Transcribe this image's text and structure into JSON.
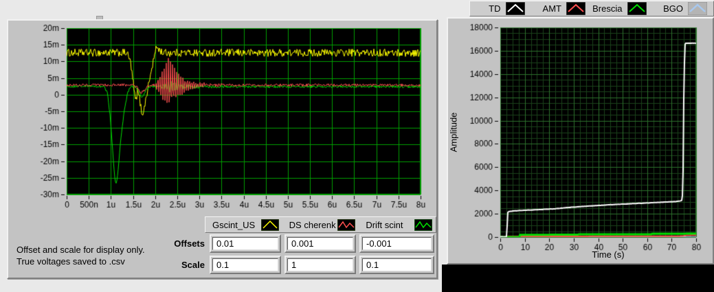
{
  "left_panel": {
    "note_line1": "Offset and scale for display only.",
    "note_line2": "True voltages saved to .csv",
    "offsets_label": "Offsets",
    "scale_label": "Scale",
    "offsets": [
      "0.01",
      "0.001",
      "-0.001"
    ],
    "scale": [
      "0.1",
      "1",
      "0.1"
    ],
    "legend": [
      {
        "label": "Gscint_US",
        "color": "#ffff00",
        "box": "#000000",
        "glyph": "caret-line"
      },
      {
        "label": "DS cherenk",
        "color": "#ff5050",
        "box": "#000000",
        "glyph": "zigzag-line"
      },
      {
        "label": "Drift scint",
        "color": "#00e400",
        "box": "#000000",
        "glyph": "zigzag-line"
      }
    ]
  },
  "right_panel": {
    "ylabel": "Amplitude",
    "xlabel": "Time (s)",
    "legend": [
      {
        "label": "TD",
        "color": "#ffffff",
        "box": "#000000",
        "glyph": "caret-line"
      },
      {
        "label": "AMT",
        "color": "#ff5050",
        "box": "#000000",
        "glyph": "caret-line"
      },
      {
        "label": "Brescia",
        "color": "#00dd00",
        "box": "#000000",
        "glyph": "caret-line"
      },
      {
        "label": "BGO",
        "color": "#a8c8ee",
        "box": "#b4b4b4",
        "glyph": "caret-line"
      }
    ]
  },
  "chart_data": [
    {
      "type": "line",
      "title": "",
      "xlabel": "",
      "ylabel": "",
      "x_unit": "seconds (n = nano, u = micro)",
      "y_unit": "volts (m = milli)",
      "x_range": [
        0,
        8
      ],
      "y_range": [
        -30,
        20
      ],
      "grid": {
        "x_step": 0.5,
        "y_step": 5
      },
      "colors": {
        "bg": "#000000",
        "grid": "#00a000"
      },
      "x_ticks": [
        {
          "v": 0,
          "l": "0"
        },
        {
          "v": 0.5,
          "l": "500n"
        },
        {
          "v": 1,
          "l": "1u"
        },
        {
          "v": 1.5,
          "l": "1.5u"
        },
        {
          "v": 2,
          "l": "2u"
        },
        {
          "v": 2.5,
          "l": "2.5u"
        },
        {
          "v": 3,
          "l": "3u"
        },
        {
          "v": 3.5,
          "l": "3.5u"
        },
        {
          "v": 4,
          "l": "4u"
        },
        {
          "v": 4.5,
          "l": "4.5u"
        },
        {
          "v": 5,
          "l": "5u"
        },
        {
          "v": 5.5,
          "l": "5.5u"
        },
        {
          "v": 6,
          "l": "6u"
        },
        {
          "v": 6.5,
          "l": "6.5u"
        },
        {
          "v": 7,
          "l": "7u"
        },
        {
          "v": 7.5,
          "l": "7.5u"
        },
        {
          "v": 8,
          "l": "8u"
        }
      ],
      "y_ticks": [
        {
          "v": 20,
          "l": "20m"
        },
        {
          "v": 15,
          "l": "15m"
        },
        {
          "v": 10,
          "l": "10m"
        },
        {
          "v": 5,
          "l": "5m"
        },
        {
          "v": 0,
          "l": "0"
        },
        {
          "v": -5,
          "l": "-5m"
        },
        {
          "v": -10,
          "l": "-10m"
        },
        {
          "v": -15,
          "l": "-15m"
        },
        {
          "v": -20,
          "l": "-20m"
        },
        {
          "v": -25,
          "l": "-25m"
        },
        {
          "v": -30,
          "l": "-30m"
        }
      ],
      "series": [
        {
          "name": "Gscint_US",
          "color": "#ffff00",
          "width": 1,
          "noise": 1.15,
          "points": [
            [
              0,
              12.6
            ],
            [
              1.36,
              12.6
            ],
            [
              1.44,
              10
            ],
            [
              1.5,
              4
            ],
            [
              1.56,
              -2.3
            ],
            [
              1.6,
              1
            ],
            [
              1.64,
              -0.5
            ],
            [
              1.7,
              -5.8
            ],
            [
              1.75,
              -4.5
            ],
            [
              1.8,
              -0.5
            ],
            [
              1.86,
              3.5
            ],
            [
              1.92,
              7.5
            ],
            [
              1.98,
              11.5
            ],
            [
              2.04,
              14.6
            ],
            [
              2.1,
              13.4
            ],
            [
              2.18,
              12.6
            ],
            [
              8,
              12.6
            ]
          ]
        },
        {
          "name": "DS cherenk",
          "color": "#ff5050",
          "width": 1,
          "noise": 0.4,
          "points": [
            [
              0,
              2.9
            ],
            [
              1.5,
              2.9
            ],
            [
              1.6,
              2.2
            ],
            [
              1.68,
              0.6
            ],
            [
              1.74,
              1.2
            ],
            [
              1.82,
              2.4
            ],
            [
              1.95,
              2.9
            ],
            [
              8,
              2.9
            ]
          ],
          "ring": {
            "t0": 2.0,
            "peak": 2.3,
            "amp": 8.5,
            "decay": 0.28,
            "freq": 21,
            "end": 3.6
          }
        },
        {
          "name": "Drift scint",
          "color": "#00e400",
          "width": 1,
          "noise": 0.35,
          "points": [
            [
              0,
              2.5
            ],
            [
              0.84,
              2.5
            ],
            [
              0.92,
              0.5
            ],
            [
              0.98,
              -6
            ],
            [
              1.04,
              -17
            ],
            [
              1.09,
              -25.5
            ],
            [
              1.12,
              -27
            ],
            [
              1.16,
              -23
            ],
            [
              1.22,
              -14
            ],
            [
              1.3,
              -5
            ],
            [
              1.38,
              0.8
            ],
            [
              1.46,
              2.6
            ],
            [
              1.56,
              2.4
            ],
            [
              1.64,
              1
            ],
            [
              1.7,
              -1.2
            ],
            [
              1.78,
              1.2
            ],
            [
              1.86,
              2.4
            ],
            [
              8,
              2.4
            ]
          ],
          "ring": {
            "t0": 2.05,
            "peak": 2.35,
            "amp": 1.4,
            "decay": 0.4,
            "freq": 17,
            "end": 3.5
          }
        }
      ]
    },
    {
      "type": "line",
      "title": "",
      "xlabel": "Time (s)",
      "ylabel": "Amplitude",
      "x_range": [
        0,
        80
      ],
      "y_range": [
        0,
        18000
      ],
      "grid": {
        "minor_x": 2.5,
        "minor_y": 500,
        "major_x": 10,
        "major_y": 2000
      },
      "colors": {
        "bg": "#000000",
        "grid_minor": "#1b431b",
        "grid_major": "#2c722c"
      },
      "x_ticks": [
        {
          "v": 0,
          "l": "0"
        },
        {
          "v": 10,
          "l": "10"
        },
        {
          "v": 20,
          "l": "20"
        },
        {
          "v": 30,
          "l": "30"
        },
        {
          "v": 40,
          "l": "40"
        },
        {
          "v": 50,
          "l": "50"
        },
        {
          "v": 60,
          "l": "60"
        },
        {
          "v": 70,
          "l": "70"
        },
        {
          "v": 80,
          "l": "80"
        }
      ],
      "y_ticks": [
        {
          "v": 0,
          "l": "0"
        },
        {
          "v": 2000,
          "l": "2000"
        },
        {
          "v": 4000,
          "l": "4000"
        },
        {
          "v": 6000,
          "l": "6000"
        },
        {
          "v": 8000,
          "l": "8000"
        },
        {
          "v": 10000,
          "l": "10000"
        },
        {
          "v": 12000,
          "l": "12000"
        },
        {
          "v": 14000,
          "l": "14000"
        },
        {
          "v": 16000,
          "l": "16000"
        },
        {
          "v": 18000,
          "l": "18000"
        }
      ],
      "series": [
        {
          "name": "TD",
          "color": "#ffffff",
          "width": 2,
          "noise": 10,
          "points": [
            [
              0,
              20
            ],
            [
              2.5,
              20
            ],
            [
              2.7,
              300
            ],
            [
              3.0,
              2100
            ],
            [
              3.6,
              2200
            ],
            [
              6,
              2250
            ],
            [
              9,
              2290
            ],
            [
              12,
              2320
            ],
            [
              15,
              2350
            ],
            [
              18,
              2380
            ],
            [
              21,
              2410
            ],
            [
              24,
              2460
            ],
            [
              27,
              2520
            ],
            [
              30,
              2570
            ],
            [
              33,
              2620
            ],
            [
              36,
              2660
            ],
            [
              39,
              2700
            ],
            [
              42,
              2740
            ],
            [
              45,
              2780
            ],
            [
              48,
              2810
            ],
            [
              51,
              2840
            ],
            [
              54,
              2870
            ],
            [
              57,
              2900
            ],
            [
              60,
              2930
            ],
            [
              63,
              2960
            ],
            [
              66,
              2990
            ],
            [
              69,
              3020
            ],
            [
              71,
              3040
            ],
            [
              73,
              3080
            ],
            [
              74.2,
              3150
            ],
            [
              74.6,
              4000
            ],
            [
              74.9,
              11700
            ],
            [
              75.1,
              12200
            ],
            [
              75.3,
              16500
            ],
            [
              75.8,
              16650
            ],
            [
              80,
              16650
            ]
          ]
        },
        {
          "name": "AMT",
          "color": "#ff5050",
          "width": 2,
          "noise": 0,
          "points": [
            [
              0,
              10
            ],
            [
              2.5,
              10
            ],
            [
              3,
              55
            ],
            [
              20,
              60
            ],
            [
              40,
              68
            ],
            [
              60,
              72
            ],
            [
              73,
              78
            ],
            [
              74.5,
              90
            ],
            [
              76,
              140
            ],
            [
              78,
              155
            ],
            [
              80,
              160
            ]
          ]
        },
        {
          "name": "Brescia",
          "color": "#00dd00",
          "width": 3,
          "noise": 0,
          "points": [
            [
              0,
              5
            ],
            [
              7.8,
              5
            ],
            [
              8,
              190
            ],
            [
              18,
              198
            ],
            [
              31.8,
              205
            ],
            [
              32,
              232
            ],
            [
              48,
              238
            ],
            [
              61.8,
              242
            ],
            [
              62,
              278
            ],
            [
              72,
              284
            ],
            [
              80,
              292
            ]
          ]
        },
        {
          "name": "BGO",
          "color": "#a8c8ee",
          "width": 2,
          "noise": 0,
          "points": [
            [
              0,
              4
            ],
            [
              80,
              4
            ]
          ]
        }
      ]
    }
  ]
}
